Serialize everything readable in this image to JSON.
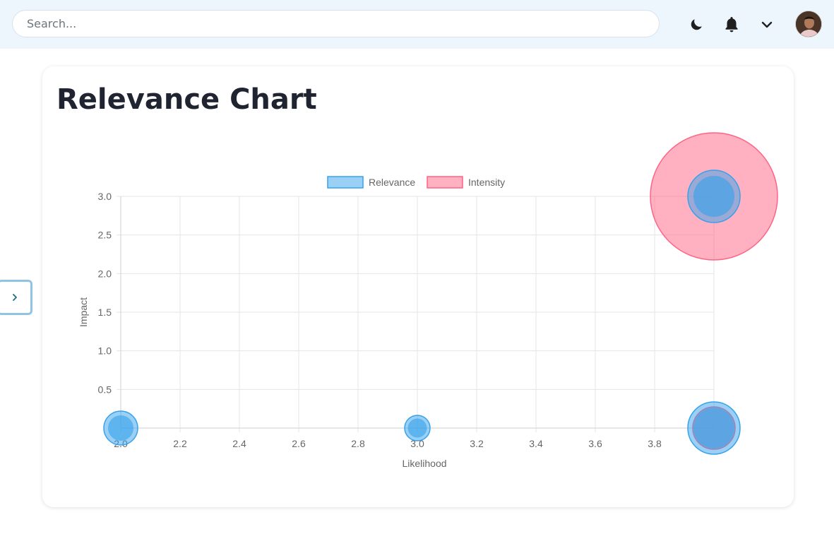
{
  "header": {
    "search_placeholder": "Search...",
    "icons": [
      "moon-icon",
      "bell-icon",
      "chevron-down-icon"
    ],
    "avatar": "user-avatar"
  },
  "card": {
    "title": "Relevance Chart"
  },
  "sidebar_toggle": {
    "icon": "chevron-right-icon",
    "color": "#1d6b80"
  },
  "chart_data": {
    "type": "bubble",
    "xlabel": "Likelihood",
    "ylabel": "Impact",
    "xlim": [
      2.0,
      4.0
    ],
    "ylim": [
      0,
      3.0
    ],
    "x_ticks": [
      "2.0",
      "2.2",
      "2.4",
      "2.6",
      "2.8",
      "3.0",
      "3.2",
      "3.4",
      "3.6",
      "3.8"
    ],
    "y_ticks": [
      "0.5",
      "1.0",
      "1.5",
      "2.0",
      "2.5",
      "3.0"
    ],
    "grid": true,
    "legend_position": "top",
    "series": [
      {
        "name": "Relevance",
        "color": "#36a2eb",
        "fill": "rgba(54,162,235,0.5)",
        "points": [
          {
            "x": 2.0,
            "y": 0,
            "r": 24
          },
          {
            "x": 3.0,
            "y": 0,
            "r": 18
          },
          {
            "x": 4.0,
            "y": 0,
            "r": 37
          },
          {
            "x": 4.0,
            "y": 3.0,
            "r": 37
          }
        ]
      },
      {
        "name": "Intensity",
        "color": "#ff6384",
        "fill": "rgba(255,99,132,0.5)",
        "points": [
          {
            "x": 4.0,
            "y": 3.0,
            "r": 90
          },
          {
            "x": 4.0,
            "y": 0,
            "r": 30
          }
        ]
      }
    ]
  }
}
